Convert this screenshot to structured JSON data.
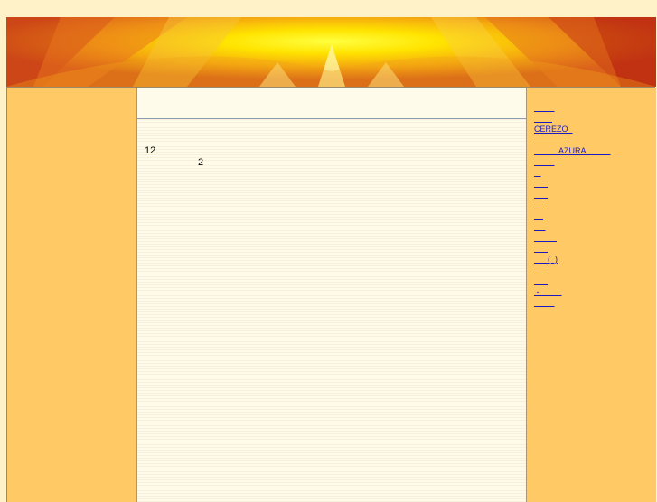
{
  "content": {
    "line1": "12",
    "line2": "2"
  },
  "nav": {
    "items": [
      {
        "label": "         "
      },
      {
        "label": "        "
      },
      {
        "label": "CEREZO  "
      },
      {
        "label": "              "
      },
      {
        "label": "           AZURA           "
      },
      {
        "label": "         "
      },
      {
        "label": "   "
      },
      {
        "label": "      "
      },
      {
        "label": "      "
      },
      {
        "label": "    "
      },
      {
        "label": "    "
      },
      {
        "label": "     "
      },
      {
        "label": "          "
      },
      {
        "label": "      "
      },
      {
        "label": "      (  )"
      },
      {
        "label": "     "
      },
      {
        "label": "      "
      },
      {
        "label": " -          "
      },
      {
        "label": "         "
      }
    ]
  },
  "colors": {
    "page_background": "#fff2c9",
    "side_background": "#ffc966",
    "main_background": "#fffbea",
    "link": "#1a1ac0"
  }
}
